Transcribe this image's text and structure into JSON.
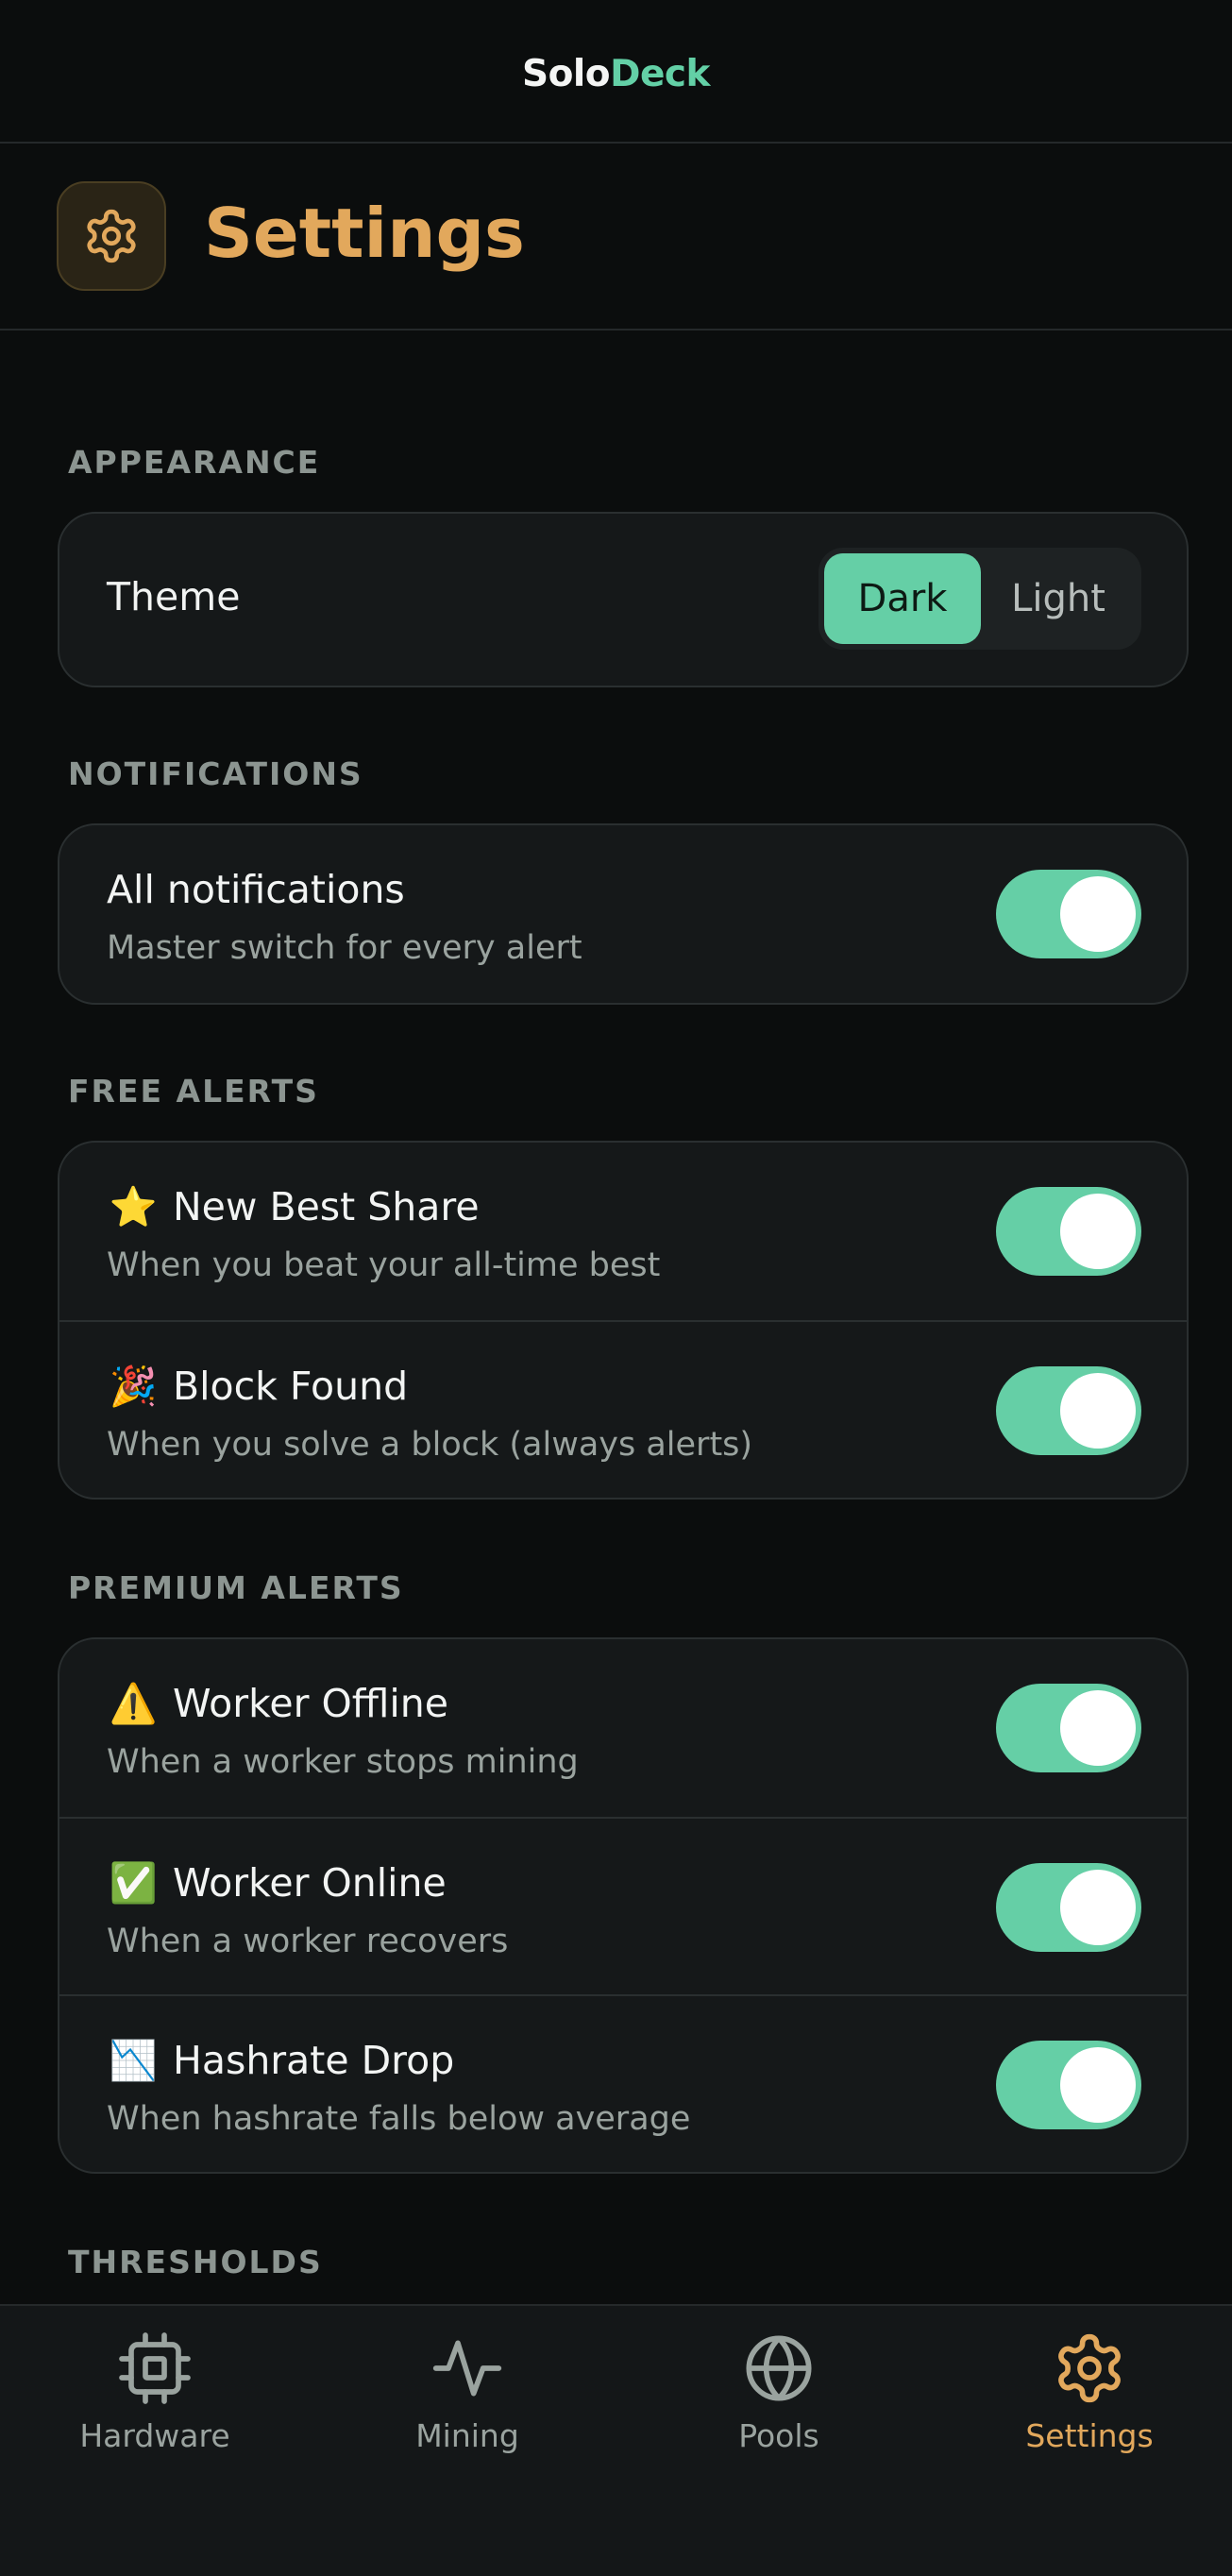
{
  "brand": {
    "part1": "Solo",
    "part2": "Deck"
  },
  "page": {
    "title": "Settings",
    "icon": "gear-icon"
  },
  "appearance": {
    "label": "APPEARANCE",
    "theme_label": "Theme",
    "options": [
      "Dark",
      "Light"
    ],
    "selected": "Dark"
  },
  "notifications": {
    "label": "NOTIFICATIONS",
    "all": {
      "title": "All notifications",
      "subtitle": "Master switch for every alert",
      "enabled": true
    }
  },
  "free_alerts": {
    "label": "FREE ALERTS",
    "items": [
      {
        "emoji": "⭐",
        "title": "New Best Share",
        "subtitle": "When you beat your all-time best",
        "enabled": true
      },
      {
        "emoji": "🎉",
        "title": "Block Found",
        "subtitle": "When you solve a block (always alerts)",
        "enabled": true
      }
    ]
  },
  "premium_alerts": {
    "label": "PREMIUM ALERTS",
    "items": [
      {
        "emoji": "⚠️",
        "title": "Worker Offline",
        "subtitle": "When a worker stops mining",
        "enabled": true
      },
      {
        "emoji": "✅",
        "title": "Worker Online",
        "subtitle": "When a worker recovers",
        "enabled": true
      },
      {
        "emoji": "📉",
        "title": "Hashrate Drop",
        "subtitle": "When hashrate falls below average",
        "enabled": true
      }
    ]
  },
  "thresholds": {
    "label": "THRESHOLDS"
  },
  "tabs": [
    {
      "label": "Hardware",
      "icon": "chip-icon",
      "active": false
    },
    {
      "label": "Mining",
      "icon": "pulse-icon",
      "active": false
    },
    {
      "label": "Pools",
      "icon": "globe-icon",
      "active": false
    },
    {
      "label": "Settings",
      "icon": "gear-icon",
      "active": true
    }
  ],
  "colors": {
    "accent": "#65cfa6",
    "settings_accent": "#e2a85c",
    "background": "#0b0d0d"
  }
}
